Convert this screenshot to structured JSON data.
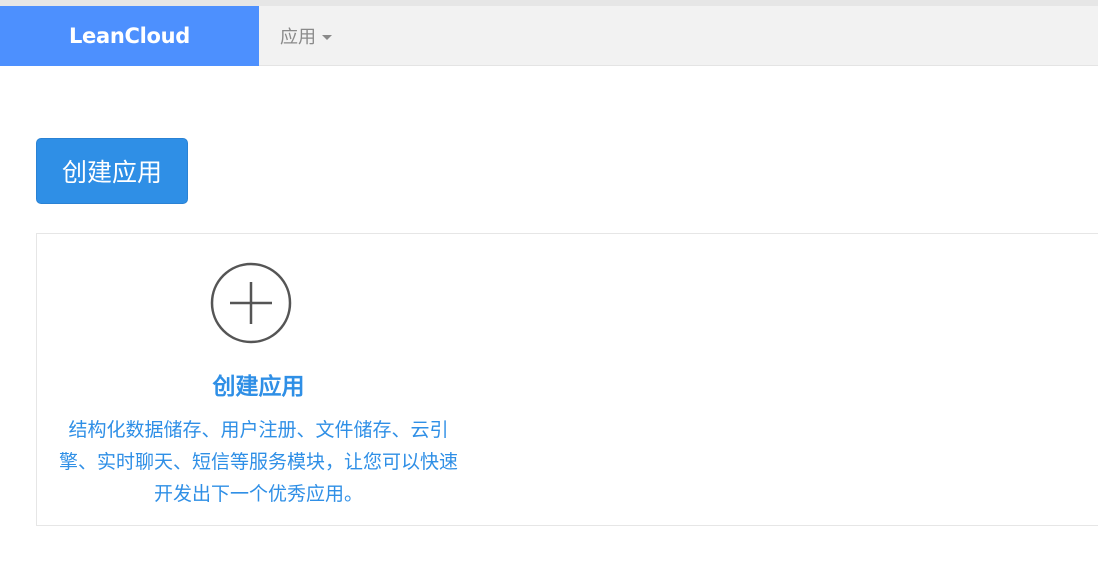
{
  "navbar": {
    "brand": "LeanCloud",
    "menu_label": "应用"
  },
  "toolbar": {
    "create_label": "创建应用"
  },
  "card": {
    "icon": "plus-circle-icon",
    "title": "创建应用",
    "description": "结构化数据储存、用户注册、文件储存、云引擎、实时聊天、短信等服务模块，让您可以快速开发出下一个优秀应用。"
  },
  "colors": {
    "brand_bg": "#4d90fe",
    "accent": "#2f8fe6",
    "navbar_bg": "#f2f2f2"
  }
}
